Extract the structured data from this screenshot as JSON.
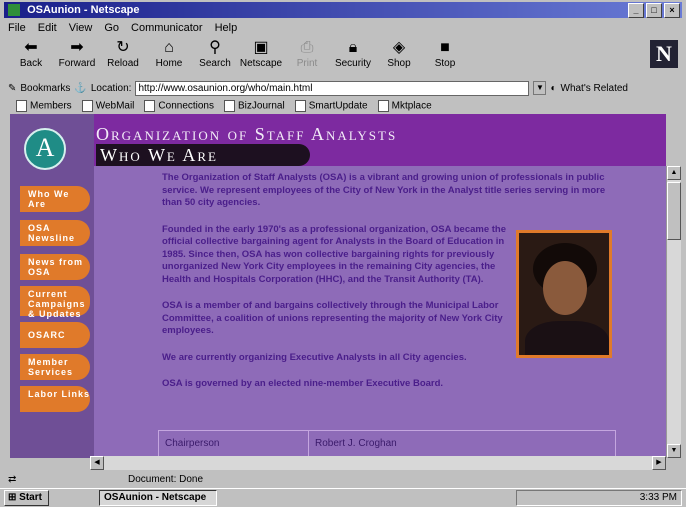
{
  "window": {
    "title": "OSAunion - Netscape"
  },
  "menu": [
    "File",
    "Edit",
    "View",
    "Go",
    "Communicator",
    "Help"
  ],
  "toolbar": [
    {
      "label": "Back",
      "icon": "back-arrow-icon"
    },
    {
      "label": "Forward",
      "icon": "forward-arrow-icon"
    },
    {
      "label": "Reload",
      "icon": "reload-icon"
    },
    {
      "label": "Home",
      "icon": "home-icon"
    },
    {
      "label": "Search",
      "icon": "search-icon"
    },
    {
      "label": "Netscape",
      "icon": "netscape-icon"
    },
    {
      "label": "Print",
      "icon": "print-icon"
    },
    {
      "label": "Security",
      "icon": "lock-icon"
    },
    {
      "label": "Shop",
      "icon": "bag-icon"
    },
    {
      "label": "Stop",
      "icon": "stop-icon"
    }
  ],
  "location": {
    "bookmarks_label": "Bookmarks",
    "location_label": "Location:",
    "url": "http://www.osaunion.org/who/main.html",
    "whats_related": "What's Related"
  },
  "personal_toolbar": [
    "Members",
    "WebMail",
    "Connections",
    "BizJournal",
    "SmartUpdate",
    "Mktplace"
  ],
  "site": {
    "org_title": "Organization of Staff Analysts",
    "page_title": "Who We Are",
    "nav": [
      "Who We Are",
      "OSA Newsline",
      "News from OSA",
      "Current Campaigns & Updates",
      "OSARC",
      "Member Services",
      "Labor Links"
    ],
    "paragraphs": [
      "The Organization of Staff Analysts (OSA) is a vibrant and growing union of professionals in public service. We represent employees of the City of New York in the Analyst title series serving in more than 50 city agencies.",
      "Founded in the early 1970's as a professional organization, OSA became the official collective bargaining agent for Analysts in the Board of Education in 1985. Since then, OSA has won collective bargaining rights for previously unorganized New York City employees in the remaining City agencies, the Health and Hospitals Corporation (HHC), and the Transit Authority (TA).",
      "OSA is a member of and bargains collectively through the Municipal Labor Committee, a coalition of unions representing the majority of New York City employees.",
      "We are currently organizing Executive Analysts in all City agencies.",
      "OSA is governed by an elected nine-member Executive Board."
    ],
    "table": {
      "role": "Chairperson",
      "name": "Robert J. Croghan"
    }
  },
  "status": {
    "text": "Document: Done"
  },
  "taskbar": {
    "start": "Start",
    "active_task": "OSAunion - Netscape",
    "clock": "3:33 PM"
  }
}
